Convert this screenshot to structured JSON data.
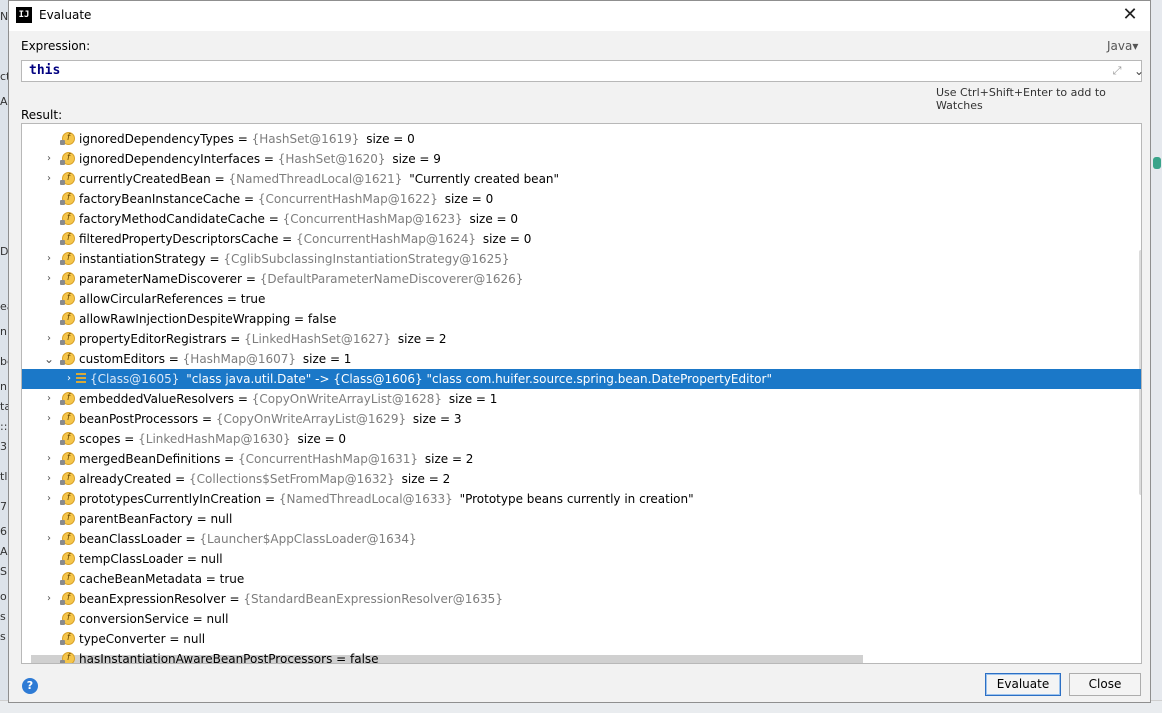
{
  "window": {
    "title": "Evaluate",
    "app_icon_text": "IJ"
  },
  "expression": {
    "label": "Expression:",
    "language": "Java▾",
    "value": "this",
    "hint": "Use Ctrl+Shift+Enter to add to Watches"
  },
  "result": {
    "label": "Result:",
    "rows": [
      {
        "arrow": false,
        "icon": "field",
        "name": "ignoredDependencyTypes",
        "ref": "{HashSet@1619}",
        "tail": "size = 0"
      },
      {
        "arrow": true,
        "icon": "field",
        "name": "ignoredDependencyInterfaces",
        "ref": "{HashSet@1620}",
        "tail": "size = 9"
      },
      {
        "arrow": true,
        "icon": "field",
        "name": "currentlyCreatedBean",
        "ref": "{NamedThreadLocal@1621}",
        "tail": "\"Currently created bean\""
      },
      {
        "arrow": false,
        "icon": "field",
        "name": "factoryBeanInstanceCache",
        "ref": "{ConcurrentHashMap@1622}",
        "tail": "size = 0"
      },
      {
        "arrow": false,
        "icon": "field",
        "name": "factoryMethodCandidateCache",
        "ref": "{ConcurrentHashMap@1623}",
        "tail": "size = 0"
      },
      {
        "arrow": false,
        "icon": "field",
        "name": "filteredPropertyDescriptorsCache",
        "ref": "{ConcurrentHashMap@1624}",
        "tail": "size = 0"
      },
      {
        "arrow": true,
        "icon": "field",
        "name": "instantiationStrategy",
        "ref": "{CglibSubclassingInstantiationStrategy@1625}",
        "tail": ""
      },
      {
        "arrow": true,
        "icon": "field",
        "name": "parameterNameDiscoverer",
        "ref": "{DefaultParameterNameDiscoverer@1626}",
        "tail": ""
      },
      {
        "arrow": false,
        "icon": "field",
        "name": "allowCircularReferences",
        "ref": "",
        "tail": "true"
      },
      {
        "arrow": false,
        "icon": "field",
        "name": "allowRawInjectionDespiteWrapping",
        "ref": "",
        "tail": "false"
      },
      {
        "arrow": true,
        "icon": "field",
        "name": "propertyEditorRegistrars",
        "ref": "{LinkedHashSet@1627}",
        "tail": "size = 2"
      },
      {
        "arrow": true,
        "expanded": true,
        "icon": "field",
        "name": "customEditors",
        "ref": "{HashMap@1607}",
        "tail": "size = 1"
      },
      {
        "arrow": true,
        "icon": "entry",
        "child": true,
        "selected": true,
        "name": "",
        "ref": "{Class@1605}",
        "tail": "\"class java.util.Date\" -> {Class@1606} \"class com.huifer.source.spring.bean.DatePropertyEditor\""
      },
      {
        "arrow": true,
        "icon": "field",
        "name": "embeddedValueResolvers",
        "ref": "{CopyOnWriteArrayList@1628}",
        "tail": "size = 1"
      },
      {
        "arrow": true,
        "icon": "field",
        "name": "beanPostProcessors",
        "ref": "{CopyOnWriteArrayList@1629}",
        "tail": "size = 3"
      },
      {
        "arrow": false,
        "icon": "field",
        "name": "scopes",
        "ref": "{LinkedHashMap@1630}",
        "tail": "size = 0"
      },
      {
        "arrow": true,
        "icon": "field",
        "name": "mergedBeanDefinitions",
        "ref": "{ConcurrentHashMap@1631}",
        "tail": "size = 2"
      },
      {
        "arrow": true,
        "icon": "field",
        "name": "alreadyCreated",
        "ref": "{Collections$SetFromMap@1632}",
        "tail": "size = 2"
      },
      {
        "arrow": true,
        "icon": "field",
        "name": "prototypesCurrentlyInCreation",
        "ref": "{NamedThreadLocal@1633}",
        "tail": "\"Prototype beans currently in creation\""
      },
      {
        "arrow": false,
        "icon": "field",
        "name": "parentBeanFactory",
        "ref": "",
        "tail": "null"
      },
      {
        "arrow": true,
        "icon": "field",
        "name": "beanClassLoader",
        "ref": "{Launcher$AppClassLoader@1634}",
        "tail": ""
      },
      {
        "arrow": false,
        "icon": "field",
        "name": "tempClassLoader",
        "ref": "",
        "tail": "null"
      },
      {
        "arrow": false,
        "icon": "field",
        "name": "cacheBeanMetadata",
        "ref": "",
        "tail": "true"
      },
      {
        "arrow": true,
        "icon": "field",
        "name": "beanExpressionResolver",
        "ref": "{StandardBeanExpressionResolver@1635}",
        "tail": ""
      },
      {
        "arrow": false,
        "icon": "field",
        "name": "conversionService",
        "ref": "",
        "tail": "null"
      },
      {
        "arrow": false,
        "icon": "field",
        "name": "typeConverter",
        "ref": "",
        "tail": "null"
      },
      {
        "arrow": false,
        "icon": "field",
        "name": "hasInstantiationAwareBeanPostProcessors",
        "ref": "",
        "tail": "false"
      }
    ]
  },
  "buttons": {
    "evaluate": "Evaluate",
    "close": "Close",
    "help": "?"
  },
  "icons": {
    "field": "f",
    "close": "✕",
    "expand": "⤢",
    "dropdown": "⌄"
  },
  "colors": {
    "selection": "#1b78c8",
    "field_icon": "#f5c54a",
    "help": "#2e7bd5"
  },
  "background_fragments": [
    "N",
    "ct",
    "A",
    "D",
    "ea",
    "n",
    "be",
    "n:",
    "ta",
    "::5",
    "3",
    "tl",
    "7",
    "6",
    "Al",
    "Si",
    "o",
    "s",
    "s"
  ]
}
